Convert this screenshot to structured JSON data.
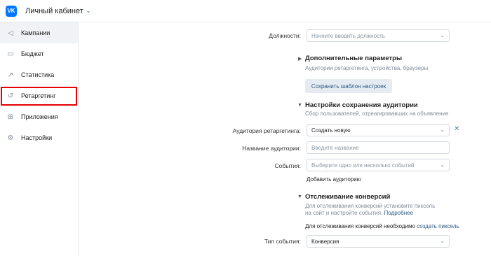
{
  "header": {
    "logo_text": "VK",
    "title": "Личный кабинет",
    "chevron": "⌄"
  },
  "sidebar": {
    "items": [
      {
        "label": "Кампании",
        "icon": "megaphone-icon",
        "glyph": "◁"
      },
      {
        "label": "Бюджет",
        "icon": "wallet-icon",
        "glyph": "▭"
      },
      {
        "label": "Статистика",
        "icon": "chart-icon",
        "glyph": "↗"
      },
      {
        "label": "Ретаргетинг",
        "icon": "retarget-icon",
        "glyph": "↺"
      },
      {
        "label": "Приложения",
        "icon": "apps-icon",
        "glyph": "⊞"
      },
      {
        "label": "Настройки",
        "icon": "gear-icon",
        "glyph": "⚙"
      }
    ],
    "active_index": 0,
    "highlight_color": "#e60000"
  },
  "form": {
    "position_label": "Должности:",
    "position_placeholder": "Начните вводить должность",
    "extra": {
      "title": "Дополнительные параметры",
      "subtitle": "Аудитории ретаргетинга, устройства, браузеры"
    },
    "save_template_button": "Сохранить шаблон настроек",
    "audience_save": {
      "title": "Настройки сохранения аудитории",
      "subtitle": "Сбор пользователей, отреагировавших на объявление"
    },
    "retarget_label": "Аудитория ретаргетинга:",
    "retarget_value": "Создать новую",
    "audience_name_label": "Название аудитории:",
    "audience_name_placeholder": "Введите название",
    "events_label": "События:",
    "events_placeholder": "Выберите одно или несколько событий",
    "add_audience_link": "Добавить аудиторию",
    "conversions": {
      "title": "Отслеживание конверсий",
      "line1": "Для отслеживания конверсий установите пиксель",
      "line2": "на сайт и настройте события.",
      "more_link": "Подробнее",
      "need_text": "Для отслеживания конверсий необходимо",
      "create_pixel_link": "создать пиксель"
    },
    "event_type_label": "Тип события:",
    "event_type_value": "Конверсия"
  },
  "colors": {
    "accent": "#0077ff",
    "link": "#2a5885",
    "button_bg": "#e5ebf1"
  }
}
